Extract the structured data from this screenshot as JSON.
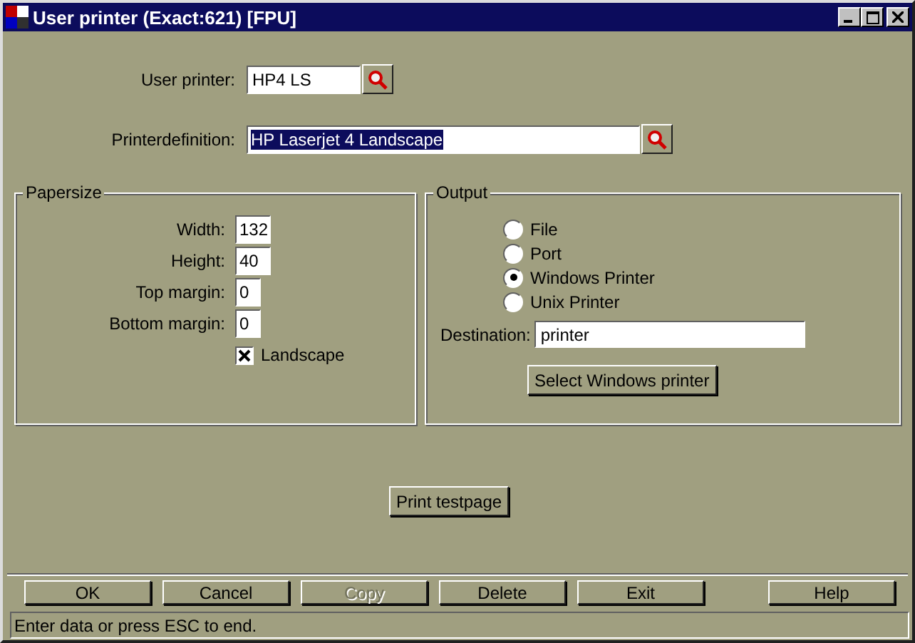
{
  "window": {
    "title": "User printer (Exact:621) [FPU]"
  },
  "user_printer": {
    "label": "User printer:",
    "value": "HP4 LS"
  },
  "printer_definition": {
    "label": "Printerdefinition:",
    "value": "HP Laserjet 4 Landscape",
    "selected": true
  },
  "papersize": {
    "title": "Papersize",
    "fields": [
      {
        "label": "Width:",
        "value": "132"
      },
      {
        "label": "Height:",
        "value": "40"
      },
      {
        "label": "Top margin:",
        "value": "0"
      },
      {
        "label": "Bottom margin:",
        "value": "0"
      }
    ],
    "landscape": {
      "label": "Landscape",
      "checked": true
    }
  },
  "output": {
    "title": "Output",
    "options": [
      {
        "label": "File",
        "selected": false
      },
      {
        "label": "Port",
        "selected": false
      },
      {
        "label": "Windows Printer",
        "selected": true
      },
      {
        "label": "Unix Printer",
        "selected": false
      }
    ],
    "destination": {
      "label": "Destination:",
      "value": "printer"
    },
    "select_button": "Select Windows printer"
  },
  "print_button": "Print testpage",
  "buttons": [
    {
      "label": "OK",
      "disabled": false
    },
    {
      "label": "Cancel",
      "disabled": false
    },
    {
      "label": "Copy",
      "disabled": true
    },
    {
      "label": "Delete",
      "disabled": false
    },
    {
      "label": "Exit",
      "disabled": false
    },
    {
      "label": "Help",
      "disabled": false
    }
  ],
  "status_bar": "Enter data or press ESC to end."
}
